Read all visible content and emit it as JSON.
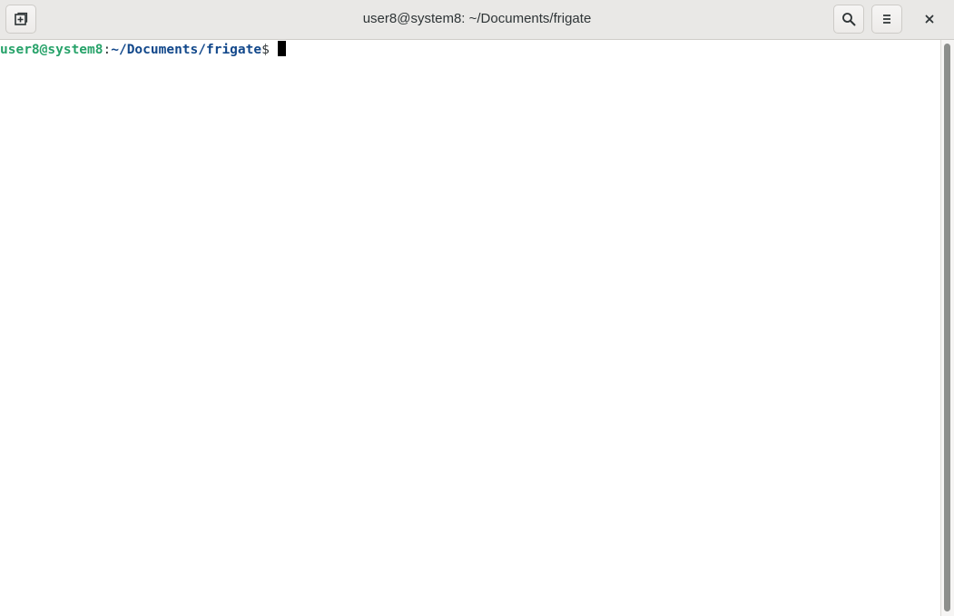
{
  "window": {
    "title": "user8@system8: ~/Documents/frigate"
  },
  "toolbar": {
    "new_tab_icon": "new-tab-icon",
    "search_icon": "search-icon",
    "menu_icon": "hamburger-menu-icon",
    "close_icon": "close-icon"
  },
  "terminal": {
    "prompt": {
      "user_host": "user8@system8",
      "separator": ":",
      "path": "~/Documents/frigate",
      "symbol": "$"
    },
    "colors": {
      "user_host": "#26a269",
      "path": "#12488b",
      "background": "#ffffff",
      "cursor": "#000000"
    }
  }
}
